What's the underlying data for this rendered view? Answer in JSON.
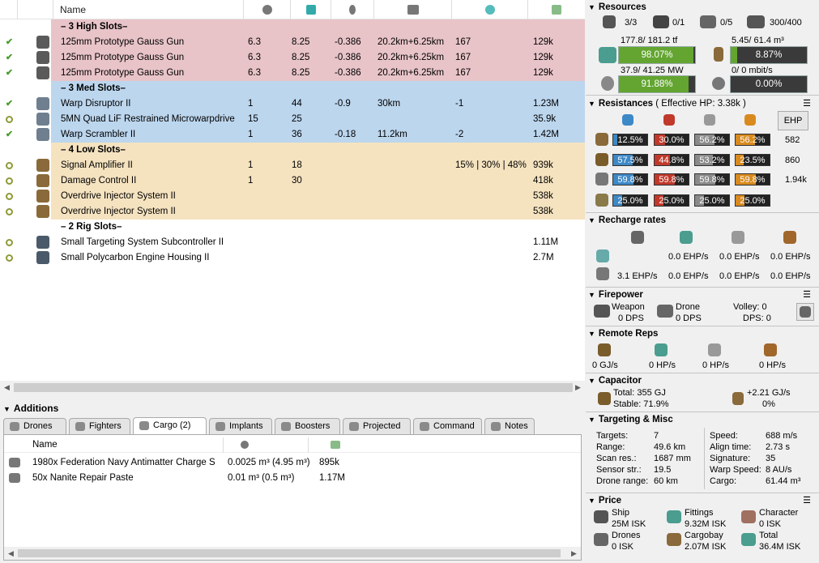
{
  "fitting": {
    "columns": {
      "name": "Name"
    },
    "sections": {
      "high": "– 3 High Slots–",
      "med": "– 3 Med Slots–",
      "low": "– 4 Low Slots–",
      "rig": "– 2 Rig Slots–"
    },
    "high_rows": [
      {
        "name": "125mm Prototype Gauss Gun",
        "c1": "6.3",
        "c2": "8.25",
        "c3": "-0.386",
        "c4": "20.2km+6.25km",
        "c5": "167",
        "c6": "",
        "c7": "129k",
        "state": "check"
      },
      {
        "name": "125mm Prototype Gauss Gun",
        "c1": "6.3",
        "c2": "8.25",
        "c3": "-0.386",
        "c4": "20.2km+6.25km",
        "c5": "167",
        "c6": "",
        "c7": "129k",
        "state": "check"
      },
      {
        "name": "125mm Prototype Gauss Gun",
        "c1": "6.3",
        "c2": "8.25",
        "c3": "-0.386",
        "c4": "20.2km+6.25km",
        "c5": "167",
        "c6": "",
        "c7": "129k",
        "state": "check"
      }
    ],
    "med_rows": [
      {
        "name": "Warp Disruptor II",
        "c1": "1",
        "c2": "44",
        "c3": "-0.9",
        "c4": "30km",
        "c5": "-1",
        "c6": "",
        "c7": "1.23M",
        "state": "check"
      },
      {
        "name": "5MN Quad LiF Restrained Microwarpdrive",
        "c1": "15",
        "c2": "25",
        "c3": "",
        "c4": "",
        "c5": "",
        "c6": "",
        "c7": "35.9k",
        "state": "circle"
      },
      {
        "name": "Warp Scrambler II",
        "c1": "1",
        "c2": "36",
        "c3": "-0.18",
        "c4": "11.2km",
        "c5": "-2",
        "c6": "",
        "c7": "1.42M",
        "state": "check"
      }
    ],
    "low_rows": [
      {
        "name": "Signal Amplifier II",
        "c1": "1",
        "c2": "18",
        "c3": "",
        "c4": "",
        "c5": "",
        "c6": "15% | 30% | 48%",
        "c7": "939k",
        "state": "circle"
      },
      {
        "name": "Damage Control II",
        "c1": "1",
        "c2": "30",
        "c3": "",
        "c4": "",
        "c5": "",
        "c6": "",
        "c7": "418k",
        "state": "circle"
      },
      {
        "name": "Overdrive Injector System II",
        "c1": "",
        "c2": "",
        "c3": "",
        "c4": "",
        "c5": "",
        "c6": "",
        "c7": "538k",
        "state": "circle"
      },
      {
        "name": "Overdrive Injector System II",
        "c1": "",
        "c2": "",
        "c3": "",
        "c4": "",
        "c5": "",
        "c6": "",
        "c7": "538k",
        "state": "circle"
      }
    ],
    "rig_rows": [
      {
        "name": "Small Targeting System Subcontroller II",
        "c7": "1.11M",
        "state": "circle"
      },
      {
        "name": "Small Polycarbon Engine Housing II",
        "c7": "2.7M",
        "state": "circle"
      }
    ]
  },
  "additions": {
    "title": "Additions",
    "tabs": [
      "Drones",
      "Fighters",
      "Cargo (2)",
      "Implants",
      "Boosters",
      "Projected",
      "Command",
      "Notes"
    ],
    "active_tab": "Cargo (2)",
    "columns": {
      "name": "Name"
    },
    "rows": [
      {
        "name": "1980x Federation Navy Antimatter Charge S",
        "volume": "0.0025 m³ (4.95 m³)",
        "price": "895k"
      },
      {
        "name": "50x Nanite Repair Paste",
        "volume": "0.01 m³ (0.5 m³)",
        "price": "1.17M"
      }
    ]
  },
  "resources": {
    "title": "Resources",
    "hardpoints": [
      "3/3",
      "0/1",
      "0/5",
      "300/400"
    ],
    "cpu_text": "177.8/ 181.2 tf",
    "cpu_pct": "98.07%",
    "cpu_fill": 0.9807,
    "power_text": "37.9/ 41.25 MW",
    "power_pct": "91.88%",
    "power_fill": 0.9188,
    "cargo_text": "5.45/ 61.4 m³",
    "cargo_pct": "8.87%",
    "cargo_fill": 0.0887,
    "bw_text": "0/ 0 mbit/s",
    "bw_pct": "0.00%",
    "bw_fill": 0
  },
  "resistances": {
    "title": "Resistances",
    "subtitle": "( Effective HP: 3.38k )",
    "ehp_button": "EHP",
    "rows": [
      {
        "vals": [
          "12.5%",
          "30.0%",
          "56.2%",
          "56.2%"
        ],
        "fills": [
          0.125,
          0.3,
          0.562,
          0.562
        ],
        "ehp": "582"
      },
      {
        "vals": [
          "57.5%",
          "44.8%",
          "53.2%",
          "23.5%"
        ],
        "fills": [
          0.575,
          0.448,
          0.532,
          0.235
        ],
        "ehp": "860"
      },
      {
        "vals": [
          "59.8%",
          "59.8%",
          "59.8%",
          "59.8%"
        ],
        "fills": [
          0.598,
          0.598,
          0.598,
          0.598
        ],
        "ehp": "1.94k"
      },
      {
        "vals": [
          "25.0%",
          "25.0%",
          "25.0%",
          "25.0%"
        ],
        "fills": [
          0.25,
          0.25,
          0.25,
          0.25
        ],
        "ehp": ""
      }
    ]
  },
  "recharge": {
    "title": "Recharge rates",
    "row1": [
      "0.0 EHP/s",
      "0.0 EHP/s",
      "0.0 EHP/s"
    ],
    "row2": [
      "3.1 EHP/s",
      "0.0 EHP/s",
      "0.0 EHP/s",
      "0.0 EHP/s"
    ]
  },
  "firepower": {
    "title": "Firepower",
    "weapon_label": "Weapon",
    "weapon_val": "0 DPS",
    "drone_label": "Drone",
    "drone_val": "0 DPS",
    "volley": "Volley: 0",
    "dps": "DPS: 0"
  },
  "remote": {
    "title": "Remote Reps",
    "vals": [
      "0 GJ/s",
      "0 HP/s",
      "0 HP/s",
      "0 HP/s"
    ]
  },
  "capacitor": {
    "title": "Capacitor",
    "total": "Total: 355 GJ",
    "stable": "Stable: 71.9%",
    "delta": "+2.21 GJ/s",
    "delta_pct": "0%"
  },
  "targeting": {
    "title": "Targeting & Misc",
    "left": [
      [
        "Targets:",
        "7"
      ],
      [
        "Range:",
        "49.6 km"
      ],
      [
        "Scan res.:",
        "1687 mm"
      ],
      [
        "Sensor str.:",
        "19.5"
      ],
      [
        "Drone range:",
        "60 km"
      ]
    ],
    "right": [
      [
        "Speed:",
        "688 m/s"
      ],
      [
        "Align time:",
        "2.73 s"
      ],
      [
        "Signature:",
        "35"
      ],
      [
        "Warp Speed:",
        "8 AU/s"
      ],
      [
        "Cargo:",
        "61.44 m³"
      ]
    ]
  },
  "price": {
    "title": "Price",
    "items": [
      {
        "label": "Ship",
        "val": "25M ISK"
      },
      {
        "label": "Fittings",
        "val": "9.32M ISK"
      },
      {
        "label": "Character",
        "val": "0 ISK"
      },
      {
        "label": "Drones",
        "val": "0 ISK"
      },
      {
        "label": "Cargobay",
        "val": "2.07M ISK"
      },
      {
        "label": "Total",
        "val": "36.4M ISK"
      }
    ]
  },
  "colors": {
    "high": "#e8c4c8",
    "med": "#bcd6ee",
    "low": "#f5e3c0",
    "bar_fill": "#63a530",
    "em": "#3d88c7",
    "thermal": "#c0392b",
    "kinetic": "#8a8a8a",
    "explosive": "#d98a1e"
  }
}
